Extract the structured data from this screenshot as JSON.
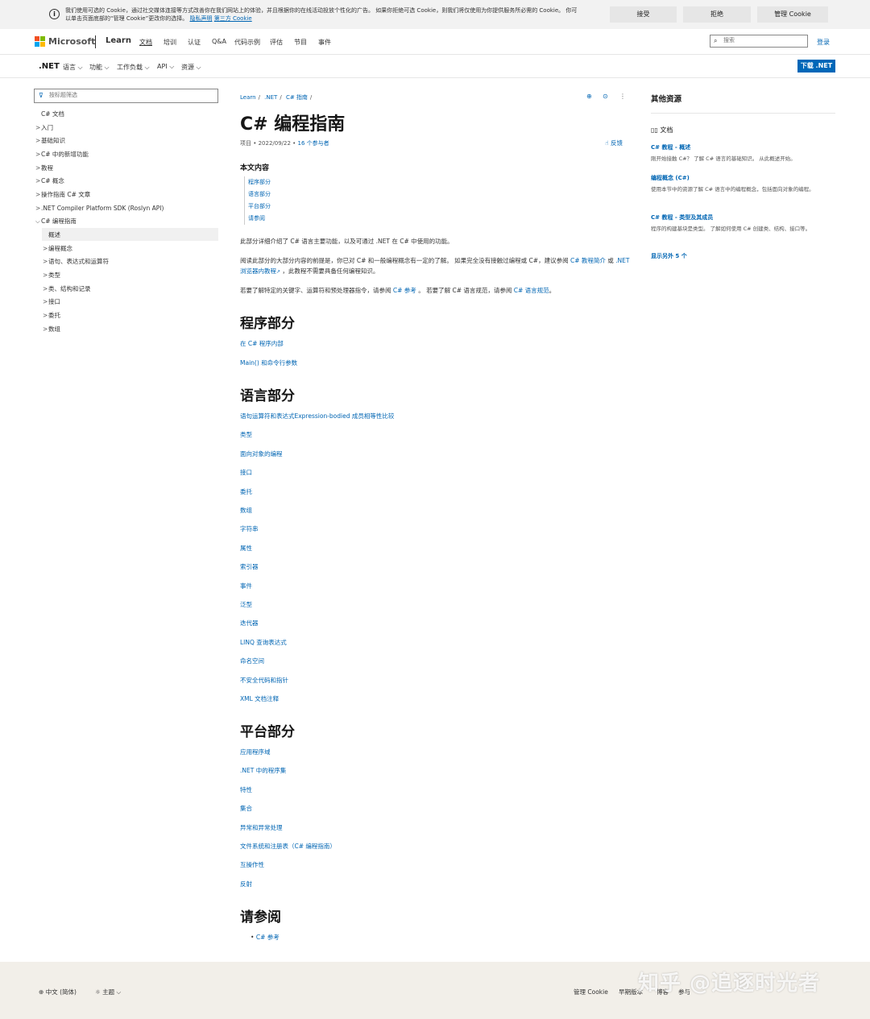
{
  "cookie": {
    "text": "我们使用可选的 Cookie，通过社交媒体连接等方式改善你在我们网站上的体验，并且根据你的在线活动投放个性化的广告。 如果你拒绝可选 Cookie，则我们将仅使用为你提供服务所必需的 Cookie。 你可以单击页面底部的“管理 Cookie”更改你的选择。",
    "privacy": "隐私声明",
    "third_party": "第三方 Cookie",
    "accept": "接受",
    "reject": "拒绝",
    "manage": "管理 Cookie"
  },
  "header": {
    "brand": "Microsoft",
    "learn": "Learn",
    "nav": [
      "文档",
      "培训",
      "认证",
      "Q&A",
      "代码示例",
      "评估",
      "节目",
      "事件"
    ],
    "search_placeholder": "搜索",
    "signin": "登录"
  },
  "subnav": {
    "product": ".NET",
    "items": [
      "语言 ⌵",
      "功能 ⌵",
      "工作负载 ⌵",
      "API ⌵",
      "资源 ⌵"
    ],
    "download": "下载 .NET"
  },
  "toc": {
    "filter_placeholder": "按标题筛选",
    "items": [
      {
        "label": "C# 文档",
        "chev": ""
      },
      {
        "label": "入门",
        "chev": ">"
      },
      {
        "label": "基础知识",
        "chev": ">"
      },
      {
        "label": "C# 中的新增功能",
        "chev": ">"
      },
      {
        "label": "教程",
        "chev": ">"
      },
      {
        "label": "C# 概念",
        "chev": ">"
      },
      {
        "label": "操作指南 C# 文章",
        "chev": ">"
      },
      {
        "label": ".NET Compiler Platform SDK (Roslyn API)",
        "chev": ">"
      },
      {
        "label": "C# 编程指南",
        "chev": "⌵"
      },
      {
        "label": "概述",
        "chev": ""
      },
      {
        "label": "编程概念",
        "chev": ">"
      },
      {
        "label": "语句、表达式和运算符",
        "chev": ">"
      },
      {
        "label": "类型",
        "chev": ">"
      },
      {
        "label": "类、结构和记录",
        "chev": ">"
      },
      {
        "label": "接口",
        "chev": ">"
      },
      {
        "label": "委托",
        "chev": ">"
      },
      {
        "label": "数组",
        "chev": ">"
      }
    ]
  },
  "main": {
    "breadcrumb": [
      "Learn",
      ".NET",
      "C# 指南"
    ],
    "title": "C# 编程指南",
    "meta_prefix": "项目 • 2022/09/22 •",
    "contributors": "16 个参与者",
    "feedback": "反馈",
    "in_this_article": "本文内容",
    "toc_links": [
      "程序部分",
      "语言部分",
      "平台部分",
      "请参阅"
    ],
    "p1": "此部分详细介绍了 C# 语言主要功能，以及可通过 .NET 在 C# 中使用的功能。",
    "p2_a": "阅读此部分的大部分内容的前提是，你已对 C# 和一般编程概念有一定的了解。 如果完全没有接触过编程或 C#，建议参阅",
    "p2_link1": "C# 教程简介",
    "p2_or": "或",
    "p2_link2": ".NET 浏览器内教程",
    "p2_b": "，此教程不需要具备任何编程知识。",
    "p3_a": "若要了解特定的关键字、运算符和预处理器指令，请参阅",
    "p3_link1": "C# 参考",
    "p3_b": "。 若要了解 C# 语言规范，请参阅",
    "p3_link2": "C# 语言规范",
    "p3_c": "。",
    "sec_program": "程序部分",
    "program_links": [
      "在 C# 程序内部",
      "Main() 和命令行参数"
    ],
    "sec_language": "语言部分",
    "language_links": [
      "语句运算符和表达式Expression-bodied 成员相等性比较",
      "类型",
      "面向对象的编程",
      "接口",
      "委托",
      "数组",
      "字符串",
      "属性",
      "索引器",
      "事件",
      "泛型",
      "迭代器",
      "LINQ 查询表达式",
      "命名空间",
      "不安全代码和指针",
      "XML 文档注释"
    ],
    "sec_platform": "平台部分",
    "platform_links": [
      "应用程序域",
      ".NET 中的程序集",
      "特性",
      "集合",
      "异常和异常处理",
      "文件系统和注册表（C# 编程指南）",
      "互操作性",
      "反射"
    ],
    "sec_see_also": "请参阅",
    "see_also_links": [
      "C# 参考"
    ]
  },
  "rail": {
    "title": "其他资源",
    "docs_label": "文档",
    "entries": [
      {
        "link": "C# 教程 - 概述",
        "desc": "刚开始接触 C#？ 了解 C# 语言的基础知识。 从此概述开始。"
      },
      {
        "link": "编程概念 (C#)",
        "desc": "使用本节中的资源了解 C# 语言中的编程概念，包括面向对象的编程。"
      },
      {
        "link": "C# 教程 - 类型及其成员",
        "desc": "程序的构建基块是类型。 了解如何使用 C# 创建类、结构、接口等。"
      }
    ],
    "show_more": "显示另外 5 个"
  },
  "footer": {
    "locale": "中文 (简体)",
    "theme": "主题",
    "manage_cookies": "管理 Cookie",
    "prev_versions": "早期版本",
    "blog": "博客",
    "contribute": "参与"
  },
  "watermark": "知乎 @追逐时光者"
}
